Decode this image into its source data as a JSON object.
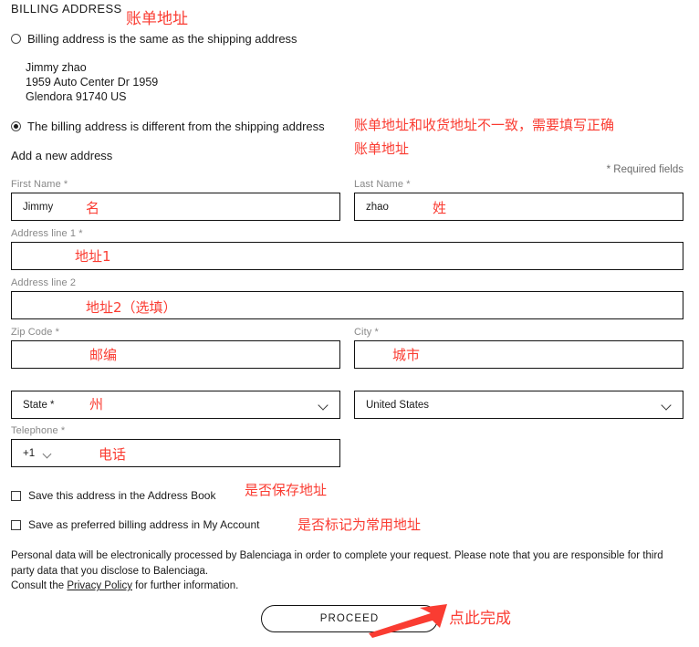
{
  "section": {
    "title": "BILLING ADDRESS",
    "required_note": "* Required fields",
    "add_new_address": "Add a new address"
  },
  "radios": [
    {
      "label": "Billing address is the same as the shipping address",
      "selected": false
    },
    {
      "label": "The billing address is different from the shipping address",
      "selected": true
    }
  ],
  "saved_address": "Jimmy zhao\n1959 Auto Center Dr 1959\nGlendora 91740 US",
  "fields": {
    "first_name": {
      "label": "First Name *",
      "value": "Jimmy",
      "placeholder": ""
    },
    "last_name": {
      "label": "Last Name *",
      "value": "zhao",
      "placeholder": ""
    },
    "address1": {
      "label": "Address line 1 *",
      "value": "",
      "placeholder": ""
    },
    "address2": {
      "label": "Address line 2",
      "value": "",
      "placeholder": ""
    },
    "zip": {
      "label": "Zip Code *",
      "value": "",
      "placeholder": ""
    },
    "city": {
      "label": "City *",
      "value": "",
      "placeholder": ""
    },
    "state": {
      "label": "",
      "value": "State *"
    },
    "country": {
      "label": "",
      "value": "United States"
    },
    "telephone": {
      "label": "Telephone *",
      "country_code": "+1",
      "value": "",
      "placeholder": ""
    }
  },
  "checkboxes": [
    {
      "label": "Save this address in the Address Book",
      "checked": false
    },
    {
      "label": "Save as preferred billing address in My Account",
      "checked": false
    }
  ],
  "legal": {
    "line1": "Personal data will be electronically processed by Balenciaga in order to complete your request. Please note that you are",
    "line2": "responsible for third party data that you disclose to Balenciaga.",
    "consult_prefix": "Consult the ",
    "link_text": "Privacy Policy",
    "consult_suffix": " for further information."
  },
  "proceed_button": "PROCEED",
  "annotations": {
    "color": "#fa3c32",
    "billing_address": "账单地址",
    "different_note": "账单地址和收货地址不一致，需要填写正确\n账单地址",
    "first_name": "名",
    "last_name": "姓",
    "address1": "地址1",
    "address2": "地址2（选填）",
    "zip": "邮编",
    "city": "城市",
    "state": "州",
    "telephone": "电话",
    "save_address": "是否保存地址",
    "preferred_address": "是否标记为常用地址",
    "proceed": "点此完成"
  }
}
